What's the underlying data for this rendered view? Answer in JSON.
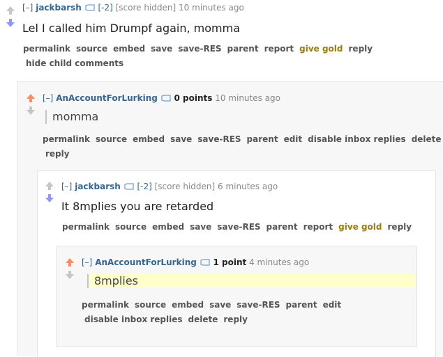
{
  "comments": [
    {
      "expand": "[–]",
      "author": "jackbarsh",
      "score": "[-2]",
      "score_note": "[score hidden]",
      "time": "10 minutes ago",
      "body": "Lel I called him Drumpf again, momma",
      "buttons": [
        "permalink",
        "source",
        "embed",
        "save",
        "save-RES",
        "parent",
        "report",
        "give gold",
        "reply"
      ],
      "hide_children": "hide child comments"
    },
    {
      "expand": "[–]",
      "author": "AnAccountForLurking",
      "score": "0 points",
      "time": "10 minutes ago",
      "body": "momma",
      "buttons": [
        "permalink",
        "source",
        "embed",
        "save",
        "save-RES",
        "parent",
        "edit",
        "disable inbox replies",
        "delete"
      ],
      "buttons_row2": [
        "reply"
      ]
    },
    {
      "expand": "[–]",
      "author": "jackbarsh",
      "score": "[-2]",
      "score_note": "[score hidden]",
      "time": "6 minutes ago",
      "body": "It 8mplies you are retarded",
      "buttons": [
        "permalink",
        "source",
        "embed",
        "save",
        "save-RES",
        "parent",
        "report",
        "give gold",
        "reply"
      ]
    },
    {
      "expand": "[–]",
      "author": "AnAccountForLurking",
      "score": "1 point",
      "time": "4 minutes ago",
      "body": "8mplies",
      "buttons": [
        "permalink",
        "source",
        "embed",
        "save",
        "save-RES",
        "parent",
        "edit"
      ],
      "buttons_row2": [
        "disable inbox replies",
        "delete",
        "reply"
      ]
    }
  ],
  "colors": {
    "upvote_active": "#ff8b60",
    "downvote_active": "#9494ff",
    "arrow_neutral": "#c6c6c6",
    "author": "#336699",
    "gold": "#9a7d0a",
    "highlight": "#ffffcc"
  },
  "icons": [
    "upvote-arrow-icon",
    "downvote-arrow-icon",
    "message-icon"
  ]
}
